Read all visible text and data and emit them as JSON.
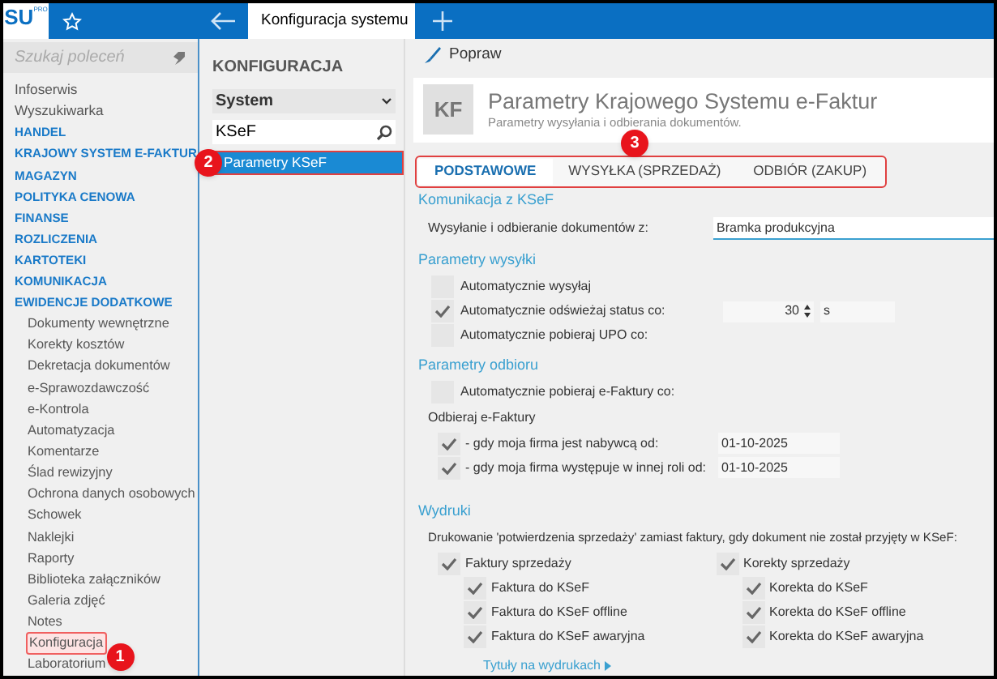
{
  "app": {
    "logo": "SU",
    "logo_badge": "PRO"
  },
  "tab": {
    "title": "Konfiguracja systemu"
  },
  "sidebar": {
    "search_placeholder": "Szukaj poleceń",
    "items": [
      {
        "label": "Infoserwis",
        "kind": "item",
        "selected": false
      },
      {
        "label": "Wyszukiwarka",
        "kind": "item",
        "selected": false
      },
      {
        "label": "HANDEL",
        "kind": "module",
        "selected": false
      },
      {
        "label": "KRAJOWY SYSTEM E-FAKTUR",
        "kind": "module",
        "selected": false
      },
      {
        "label": "MAGAZYN",
        "kind": "module",
        "selected": false
      },
      {
        "label": "POLITYKA CENOWA",
        "kind": "module",
        "selected": false
      },
      {
        "label": "FINANSE",
        "kind": "module",
        "selected": false
      },
      {
        "label": "ROZLICZENIA",
        "kind": "module",
        "selected": false
      },
      {
        "label": "KARTOTEKI",
        "kind": "module",
        "selected": false
      },
      {
        "label": "KOMUNIKACJA",
        "kind": "module",
        "selected": false
      },
      {
        "label": "EWIDENCJE DODATKOWE",
        "kind": "module",
        "selected": false,
        "children": [
          {
            "label": "Dokumenty wewnętrzne",
            "selected": false
          },
          {
            "label": "Korekty kosztów",
            "selected": false
          },
          {
            "label": "Dekretacja dokumentów",
            "selected": false
          },
          {
            "label": "e-Sprawozdawczość",
            "selected": false
          },
          {
            "label": "e-Kontrola",
            "selected": false
          },
          {
            "label": "Automatyzacja",
            "selected": false
          },
          {
            "label": "Komentarze",
            "selected": false
          },
          {
            "label": "Ślad rewizyjny",
            "selected": false
          },
          {
            "label": "Ochrona danych osobowych",
            "selected": false
          },
          {
            "label": "Schowek",
            "selected": false
          },
          {
            "label": "Naklejki",
            "selected": false
          },
          {
            "label": "Raporty",
            "selected": false
          },
          {
            "label": "Biblioteka załączników",
            "selected": false
          },
          {
            "label": "Galeria zdjęć",
            "selected": false
          },
          {
            "label": "Notes",
            "selected": false
          },
          {
            "label": "Konfiguracja",
            "selected": true,
            "callout": "1"
          },
          {
            "label": "Laboratorium",
            "selected": false
          }
        ]
      }
    ]
  },
  "config_panel": {
    "title": "KONFIGURACJA",
    "dropdown": "System",
    "search": "KSeF",
    "items": [
      {
        "label": "Parametry KSeF",
        "selected": true,
        "callout": "2"
      }
    ]
  },
  "toolbar": {
    "button": "Popraw"
  },
  "header": {
    "icon_text": "KF",
    "title": "Parametry Krajowego Systemu e-Faktur",
    "subtitle": "Parametry wysyłania i odbierania dokumentów."
  },
  "tabs": {
    "callout": "3",
    "items": [
      {
        "label": "PODSTAWOWE",
        "selected": true
      },
      {
        "label": "WYSYŁKA (SPRZEDAŻ)",
        "selected": false
      },
      {
        "label": "ODBIÓR (ZAKUP)",
        "selected": false
      }
    ]
  },
  "sections": {
    "komunikacja": {
      "title": "Komunikacja z KSeF",
      "label": "Wysyłanie i odbieranie dokumentów z:",
      "value": "Bramka produkcyjna"
    },
    "wysylka": {
      "title": "Parametry wysyłki",
      "rows": [
        {
          "label": "Automatycznie wysyłaj",
          "checked": false
        },
        {
          "label": "Automatycznie odświeżaj status co:",
          "checked": true,
          "value": "30",
          "unit": "s"
        },
        {
          "label": "Automatycznie pobieraj UPO co:",
          "checked": false
        }
      ]
    },
    "odbior": {
      "title": "Parametry odbioru",
      "auto": {
        "label": "Automatycznie pobieraj e-Faktury co:",
        "checked": false
      },
      "sub_title": "Odbieraj e-Faktury",
      "rows": [
        {
          "label": "- gdy moja firma jest nabywcą od:",
          "checked": true,
          "value": "01-10-2025"
        },
        {
          "label": "- gdy moja firma występuje w innej roli od:",
          "checked": true,
          "value": "01-10-2025"
        }
      ]
    },
    "wydruki": {
      "title": "Wydruki",
      "description": "Drukowanie 'potwierdzenia sprzedaży' zamiast faktury, gdy dokument nie został przyjęty w KSeF:",
      "groups": [
        {
          "label": "Faktury sprzedaży",
          "checked": true,
          "items": [
            {
              "label": "Faktura do KSeF",
              "checked": true
            },
            {
              "label": "Faktura do KSeF offline",
              "checked": true
            },
            {
              "label": "Faktura do KSeF awaryjna",
              "checked": true
            }
          ]
        },
        {
          "label": "Korekty sprzedaży",
          "checked": true,
          "items": [
            {
              "label": "Korekta do KSeF",
              "checked": true
            },
            {
              "label": "Korekta do KSeF offline",
              "checked": true
            },
            {
              "label": "Korekta do KSeF awaryjna",
              "checked": true
            }
          ]
        }
      ],
      "link": "Tytuły na wydrukach"
    }
  }
}
